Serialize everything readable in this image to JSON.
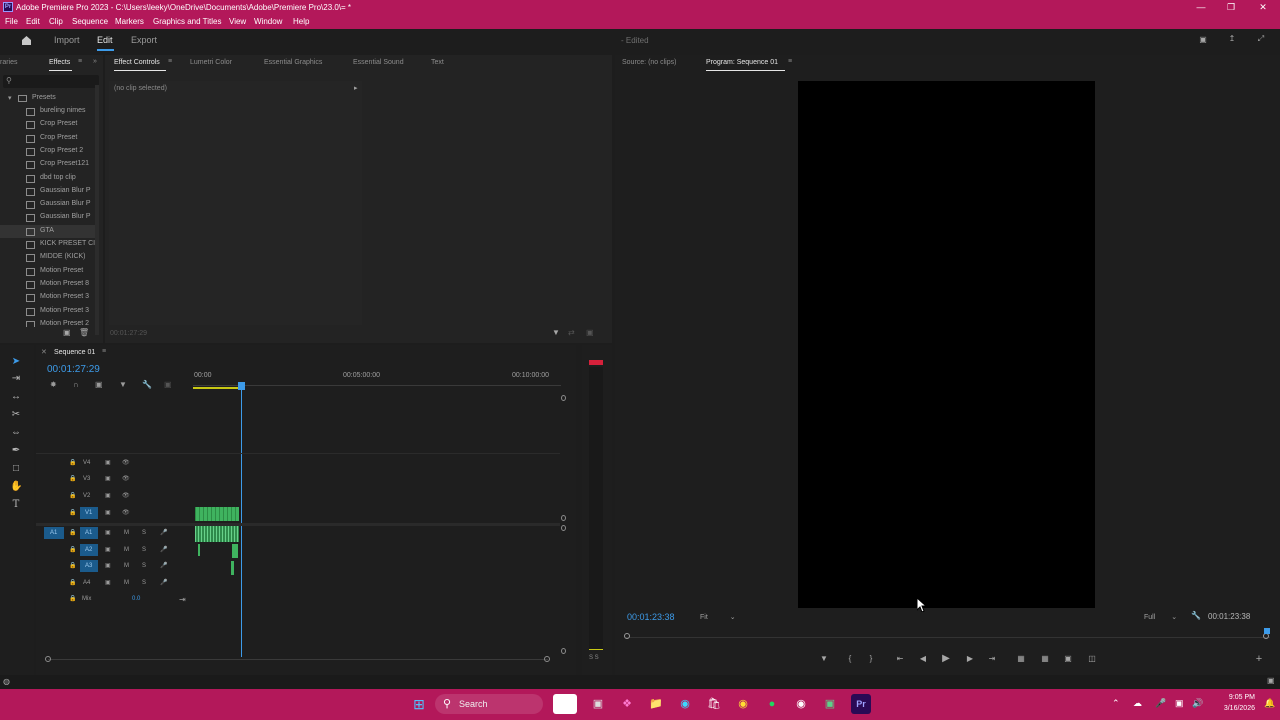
{
  "window": {
    "logo": "Pr",
    "title": "Adobe Premiere Pro 2023 - C:\\Users\\leeky\\OneDrive\\Documents\\Adobe\\Premiere Pro\\23.0\\= *",
    "controls": [
      "—",
      "❐",
      "✕"
    ]
  },
  "menu": [
    "File",
    "Edit",
    "Clip",
    "Sequence",
    "Markers",
    "Graphics and Titles",
    "View",
    "Window",
    "Help"
  ],
  "workspace": {
    "items": [
      "Import",
      "Edit",
      "Export"
    ],
    "active": "Edit",
    "doc_status": "- Edited"
  },
  "effects_panel": {
    "tab_left": "raries",
    "tab": "Effects",
    "folder": "Presets",
    "presets": [
      "bureling nimes",
      "Crop Preset",
      "Crop Preset",
      "Crop Preset 2",
      "Crop Preset121",
      "dbd top clip",
      "Gaussian Blur P",
      "Gaussian Blur P",
      "Gaussian Blur P",
      "GTA",
      "KICK PRESET CI",
      "MIDDE (KICK)",
      "Motion Preset",
      "Motion Preset 8",
      "Motion Preset 3",
      "Motion Preset 3",
      "Motion Preset 2"
    ]
  },
  "source_tabs": {
    "tabs": [
      "Effect Controls",
      "Lumetri Color",
      "Essential Graphics",
      "Essential Sound",
      "Text"
    ],
    "active": "Effect Controls",
    "no_clip": "(no clip selected)",
    "footer_time": "00:01:27:29"
  },
  "program": {
    "tabs": [
      "Source: (no clips)",
      "Program: Sequence 01"
    ],
    "active": "Program: Sequence 01",
    "timecode": "00:01:23:38",
    "fit": "Fit",
    "resolution": "Full",
    "duration": "00:01:23:38"
  },
  "timeline": {
    "sequence_name": "Sequence 01",
    "timecode": "00:01:27:29",
    "ruler": [
      "00:00",
      "00:05:00:00",
      "00:10:00:00"
    ],
    "video_tracks": [
      "V4",
      "V3",
      "V2",
      "V1"
    ],
    "audio_tracks": [
      "A1",
      "A2",
      "A3",
      "A4"
    ],
    "mix_label": "Mix",
    "mix_value": "0.0",
    "source_patch_audio": "A1",
    "m": "M",
    "s": "S",
    "meter_label": "S S"
  },
  "taskbar": {
    "search": "Search",
    "time": "9:05 PM",
    "date": "3/16/2026"
  },
  "colors": {
    "accent": "#b3185a",
    "timecode_blue": "#3d9be9",
    "clip_green": "#3fb35f",
    "playhead": "#3d9be9"
  }
}
